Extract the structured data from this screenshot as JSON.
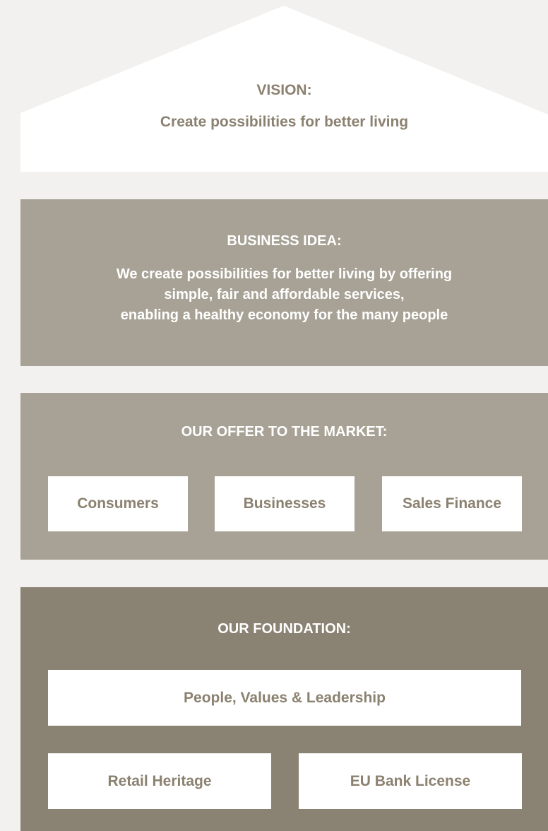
{
  "vision": {
    "heading": "VISION:",
    "text": "Create possibilities for better living"
  },
  "business_idea": {
    "heading": "BUSINESS IDEA:",
    "lines": [
      "We create possibilities for better living by offering",
      "simple, fair and affordable services,",
      "enabling a healthy economy for the many people"
    ]
  },
  "offer": {
    "heading": "OUR OFFER TO THE MARKET:",
    "items": [
      "Consumers",
      "Businesses",
      "Sales Finance"
    ]
  },
  "foundation": {
    "heading": "OUR FOUNDATION:",
    "items": [
      "People, Values & Leadership",
      "Retail Heritage",
      "EU Bank License"
    ]
  },
  "colors": {
    "background": "#f2f1ef",
    "light_panel": "#a7a295",
    "dark_panel": "#8a8272",
    "text_brown": "#8b8170",
    "white": "#ffffff"
  }
}
